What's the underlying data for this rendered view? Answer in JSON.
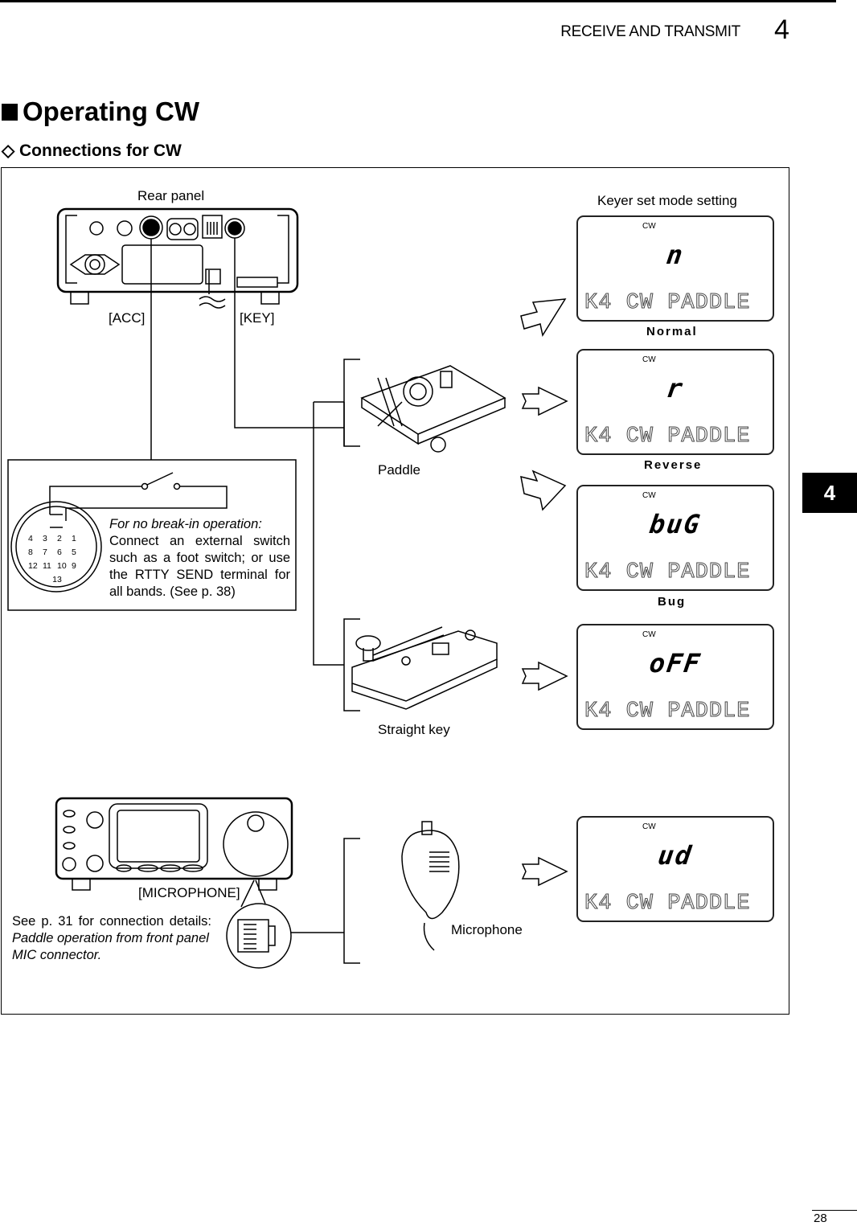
{
  "header": {
    "section_title": "RECEIVE AND TRANSMIT",
    "chapter_number": "4"
  },
  "heading": "Operating CW",
  "subheading": "Connections for CW",
  "diagram": {
    "rear_panel_label": "Rear panel",
    "acc_label": "[ACC]",
    "key_label": "[KEY]",
    "acc_pins": [
      "4",
      "3",
      "2",
      "1",
      "8",
      "7",
      "6",
      "5",
      "12",
      "11",
      "10",
      "9",
      "13"
    ],
    "note_title": "For no break-in operation:",
    "note_lines": [
      "Connect an external switch",
      "such as a foot switch; or use",
      "the RTTY SEND terminal for",
      "all bands. (See p. 38)"
    ],
    "paddle_label": "Paddle",
    "straight_key_label": "Straight key",
    "microphone_label": "Microphone",
    "microphone_connector_label": "[MICROPHONE]",
    "mic_note_line1": "See p. 31 for connection details:",
    "mic_note_line2": "Paddle operation from front panel",
    "mic_note_line3": "MIC connector.",
    "keyer_title": "Keyer set mode setting",
    "displays": [
      {
        "indicator": "CW",
        "value": "n",
        "text": "K4  CW PADDLE",
        "caption": "Normal"
      },
      {
        "indicator": "CW",
        "value": "r",
        "text": "K4  CW PADDLE",
        "caption": "Reverse"
      },
      {
        "indicator": "CW",
        "value": "buG",
        "text": "K4  CW PADDLE",
        "caption": "Bug"
      },
      {
        "indicator": "CW",
        "value": "oFF",
        "text": "K4  CW PADDLE",
        "caption": ""
      },
      {
        "indicator": "CW",
        "value": "ud",
        "text": "K4  CW PADDLE",
        "caption": ""
      }
    ]
  },
  "side_tab": "4",
  "page_number": "28"
}
